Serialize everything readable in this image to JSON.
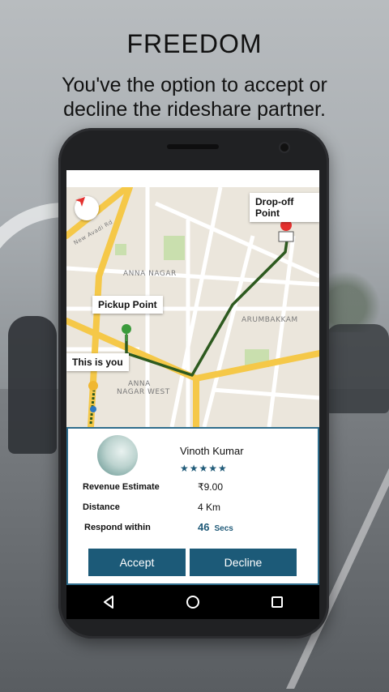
{
  "headline": "FREEDOM",
  "subline": "You've the option to accept or decline the rideshare partner.",
  "map": {
    "labels": {
      "anna_nagar": "ANNA NAGAR",
      "arumbakkam": "ARUMBAKKAM",
      "anna_nagar_west_1": "ANNA",
      "anna_nagar_west_2": "NAGAR WEST",
      "road_new_avadi": "New Avadi Rd"
    },
    "callouts": {
      "pickup": "Pickup Point",
      "you": "This is you",
      "dropoff": "Drop-off Point"
    },
    "icons": {
      "compass": "compass-icon",
      "locate": "locate-icon"
    },
    "colors": {
      "route": "#2d5a1f",
      "road": "#f5c848",
      "pin_green": "#3b9a3b",
      "pin_yellow": "#f0b731",
      "pin_red": "#e4312f"
    }
  },
  "driver": {
    "name": "Vinoth Kumar",
    "stars": "★★★★★",
    "rows": [
      {
        "label": "Revenue Estimate",
        "value": "₹9.00"
      },
      {
        "label": "Distance",
        "value": "4 Km"
      },
      {
        "label": "Respond within",
        "value": "46",
        "unit": "Secs"
      }
    ]
  },
  "buttons": {
    "accept": "Accept",
    "decline": "Decline"
  },
  "colors": {
    "accent": "#1c5a78",
    "border": "#2f6d8c"
  }
}
